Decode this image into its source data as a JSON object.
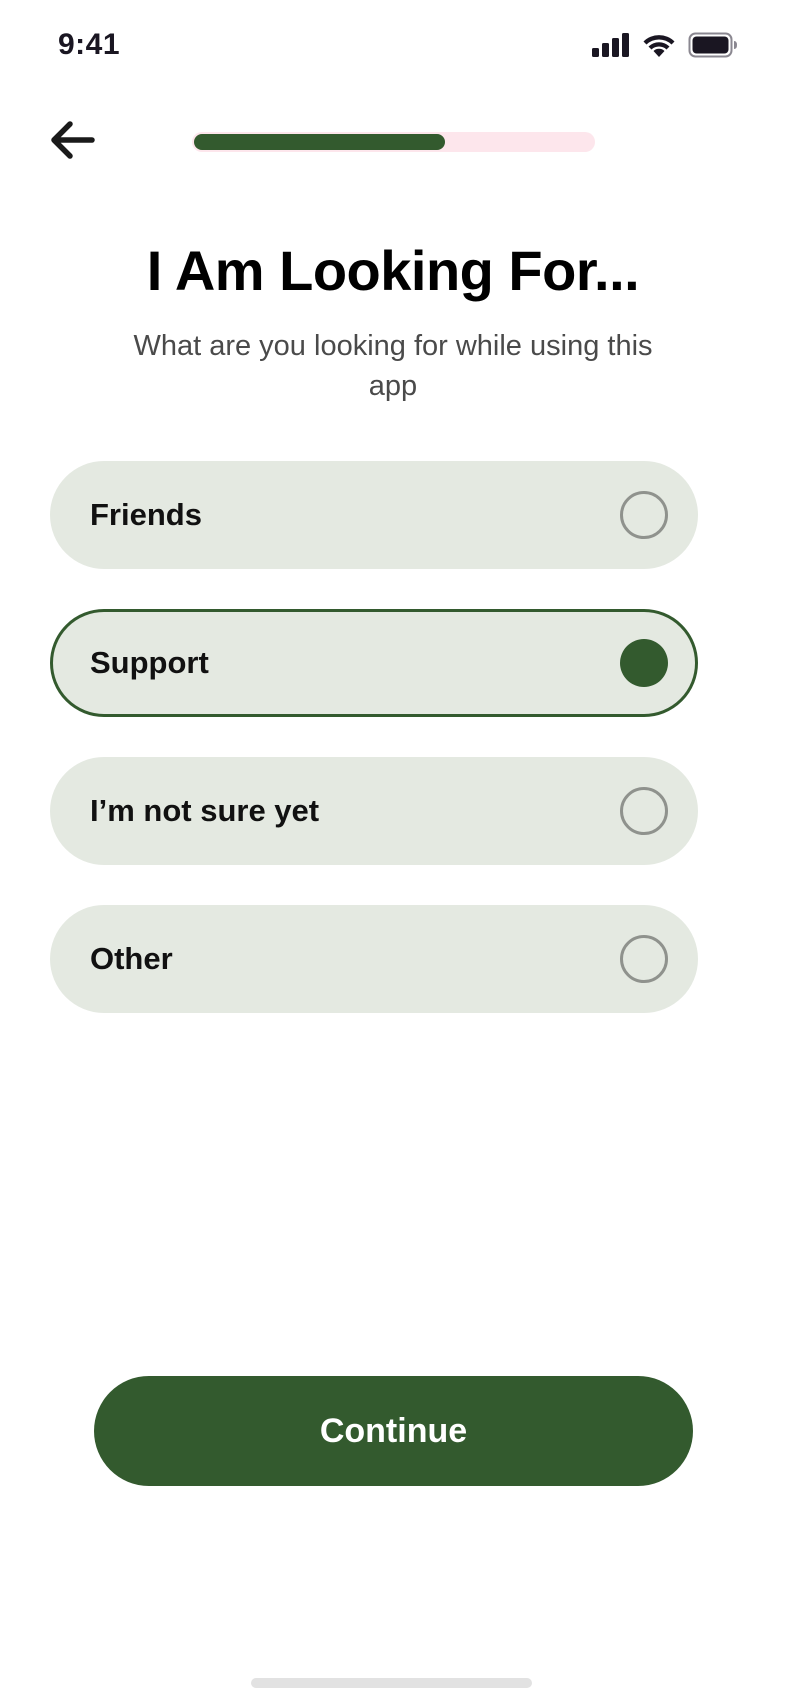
{
  "status_bar": {
    "time": "9:41",
    "icons": [
      "cellular-signal-icon",
      "wifi-icon",
      "battery-icon"
    ]
  },
  "header": {
    "back_icon": "arrow-left-icon",
    "progress": 0.63
  },
  "title": "I Am Looking For...",
  "subtitle": "What are you looking for while using this app",
  "options": [
    {
      "label": "Friends",
      "selected": false
    },
    {
      "label": "Support",
      "selected": true
    },
    {
      "label": "I’m not sure yet",
      "selected": false
    },
    {
      "label": "Other",
      "selected": false
    }
  ],
  "continue_label": "Continue",
  "colors": {
    "accent": "#335a2e",
    "option_background": "#e4e9e1",
    "progress_track": "#fde6ec",
    "radio_border": "#8f928d"
  }
}
